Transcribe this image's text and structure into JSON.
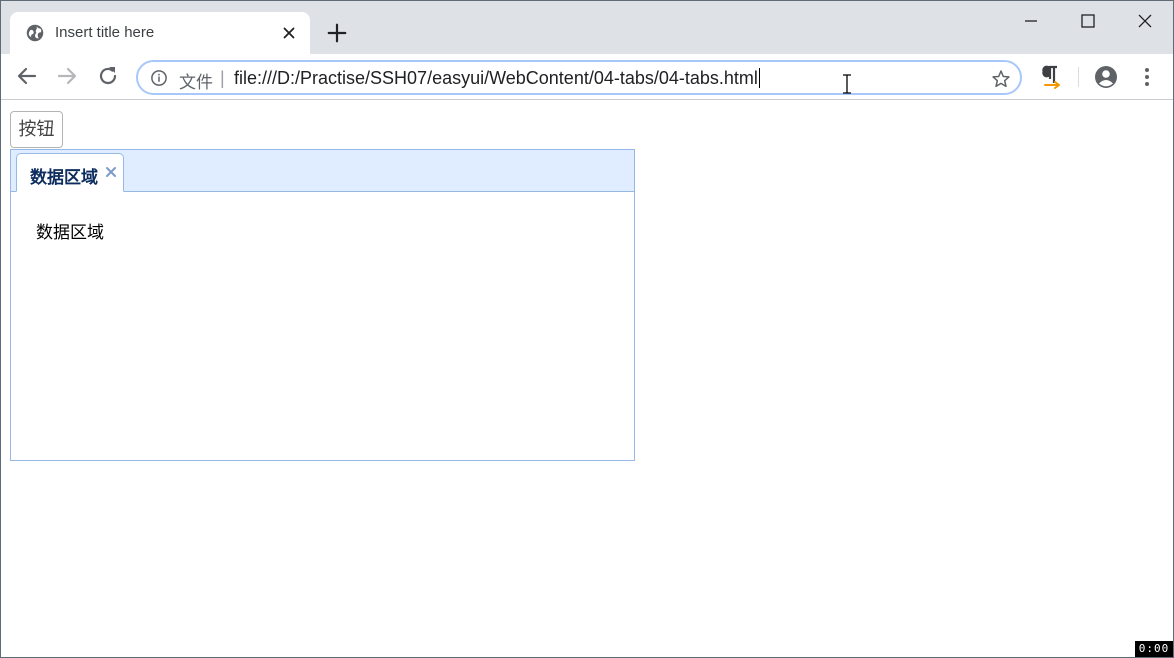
{
  "browser": {
    "tab": {
      "title": "Insert title here",
      "icon": "globe-icon"
    },
    "address_bar": {
      "scheme_label": "文件",
      "separator": "|",
      "url": "file:///D:/Practise/SSH07/easyui/WebContent/04-tabs/04-tabs.html"
    }
  },
  "page": {
    "button_label": "按钮",
    "tabs": [
      {
        "title": "数据区域",
        "content": "数据区域"
      }
    ]
  },
  "overlay": {
    "timer": "0:00"
  },
  "colors": {
    "tab_header_bg": "#e0ecff",
    "tab_border": "#95b8e7",
    "tab_title": "#0e2d5f",
    "omnibox_focus": "#a8c7fa",
    "extension_accent": "#f29900"
  }
}
